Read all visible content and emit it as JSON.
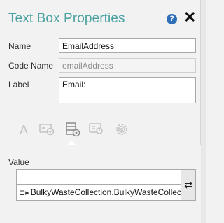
{
  "header": {
    "title": "Text Box Properties",
    "help_glyph": "?",
    "close_glyph": "✕"
  },
  "fields": {
    "name_label": "Name",
    "name_value": "EmailAddress",
    "code_name_label": "Code Name",
    "code_name_value": "emailAddress",
    "label_label": "Label",
    "label_value": "Email:"
  },
  "tabs": [
    {
      "name": "text-format-icon",
      "glyph": "A"
    },
    {
      "name": "behavior-icon"
    },
    {
      "name": "data-icon",
      "active": true
    },
    {
      "name": "validation-icon"
    },
    {
      "name": "settings-icon"
    }
  ],
  "value": {
    "label": "Value",
    "input_value": "",
    "binding_glyph": "⊐▸",
    "binding_text": "BulkyWasteCollection.BulkyWasteCollect",
    "swap_glyph": "⇄"
  },
  "colors": {
    "title": "#4aa2a0",
    "help": "#2f6fb8",
    "tab_inactive": "#c3c3c3",
    "tab_active": "#8a8a8a"
  }
}
